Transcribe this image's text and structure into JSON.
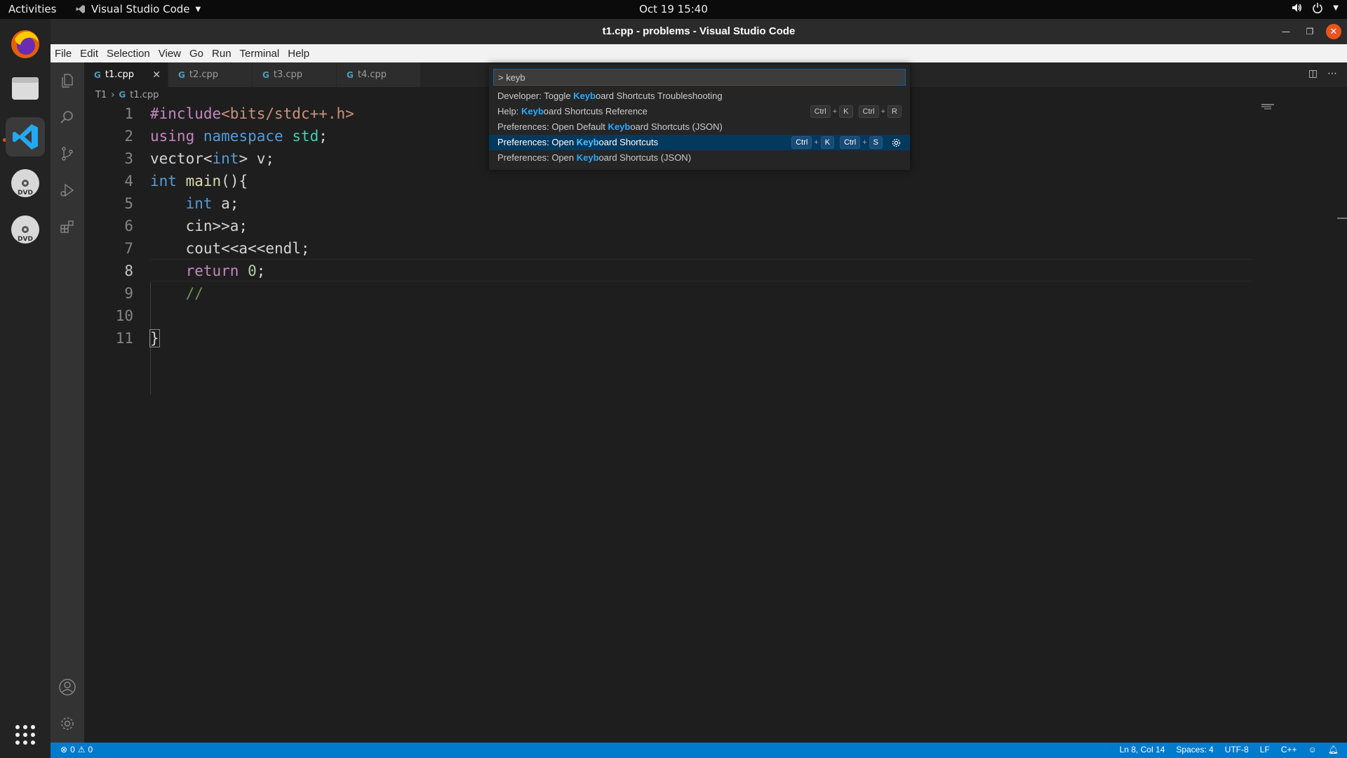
{
  "topbar": {
    "activities": "Activities",
    "app_name": "Visual Studio Code",
    "clock": "Oct 19  15:40"
  },
  "window": {
    "title": "t1.cpp - problems - Visual Studio Code"
  },
  "menu": [
    "File",
    "Edit",
    "Selection",
    "View",
    "Go",
    "Run",
    "Terminal",
    "Help"
  ],
  "tabs": [
    {
      "label": "t1.cpp",
      "active": true
    },
    {
      "label": "t2.cpp",
      "active": false
    },
    {
      "label": "t3.cpp",
      "active": false
    },
    {
      "label": "t4.cpp",
      "active": false
    }
  ],
  "breadcrumb": {
    "folder": "T1",
    "file": "t1.cpp"
  },
  "editor": {
    "line_numbers": [
      "1",
      "2",
      "3",
      "4",
      "5",
      "6",
      "7",
      "8",
      "9",
      "10",
      "11"
    ],
    "current_line": 8
  },
  "palette": {
    "input_value": "> keyb",
    "items": [
      {
        "pre": "Developer: Toggle ",
        "match": "Keyb",
        "post": "oard Shortcuts Troubleshooting"
      },
      {
        "pre": "Help: ",
        "match": "Keyb",
        "post": "oard Shortcuts Reference",
        "chord1": [
          "Ctrl",
          "K"
        ],
        "chord2": [
          "Ctrl",
          "R"
        ]
      },
      {
        "pre": "Preferences: Open Default ",
        "match": "Keyb",
        "post": "oard Shortcuts (JSON)"
      },
      {
        "pre": "Preferences: Open ",
        "match": "Keyb",
        "post": "oard Shortcuts",
        "chord1": [
          "Ctrl",
          "K"
        ],
        "chord2": [
          "Ctrl",
          "S"
        ]
      },
      {
        "pre": "Preferences: Open ",
        "match": "Keyb",
        "post": "oard Shortcuts (JSON)"
      }
    ],
    "plus": "+"
  },
  "status": {
    "errors": "0",
    "warnings": "0",
    "position": "Ln 8, Col 14",
    "spaces": "Spaces: 4",
    "encoding": "UTF-8",
    "eol": "LF",
    "language": "C++"
  },
  "colors": {
    "accent": "#007acc",
    "selection": "#04395e",
    "ubuntu_orange": "#e95420"
  }
}
